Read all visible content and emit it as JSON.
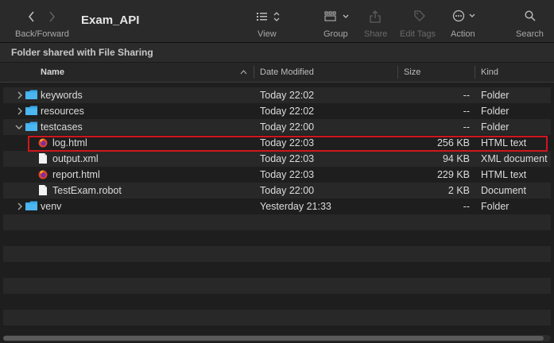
{
  "window": {
    "title": "Exam_API"
  },
  "toolbar": {
    "back_forward_label": "Back/Forward",
    "view_label": "View",
    "group_label": "Group",
    "share_label": "Share",
    "edit_tags_label": "Edit Tags",
    "action_label": "Action",
    "search_label": "Search"
  },
  "pathbar": {
    "text": "Folder shared with File Sharing"
  },
  "columns": {
    "name": "Name",
    "date_modified": "Date Modified",
    "size": "Size",
    "kind": "Kind"
  },
  "rows": [
    {
      "name": "keywords",
      "date": "Today 22:02",
      "size": "--",
      "kind": "Folder",
      "icon": "folder-icon",
      "expanded": false
    },
    {
      "name": "resources",
      "date": "Today 22:02",
      "size": "--",
      "kind": "Folder",
      "icon": "folder-icon",
      "expanded": false
    },
    {
      "name": "testcases",
      "date": "Today 22:00",
      "size": "--",
      "kind": "Folder",
      "icon": "folder-icon",
      "expanded": true
    },
    {
      "name": "log.html",
      "date": "Today 22:03",
      "size": "256 KB",
      "kind": "HTML text",
      "icon": "firefox-html-icon"
    },
    {
      "name": "output.xml",
      "date": "Today 22:03",
      "size": "94 KB",
      "kind": "XML document",
      "icon": "document-icon"
    },
    {
      "name": "report.html",
      "date": "Today 22:03",
      "size": "229 KB",
      "kind": "HTML text",
      "icon": "firefox-html-icon"
    },
    {
      "name": "TestExam.robot",
      "date": "Today 22:00",
      "size": "2 KB",
      "kind": "Document",
      "icon": "document-icon"
    },
    {
      "name": "venv",
      "date": "Yesterday 21:33",
      "size": "--",
      "kind": "Folder",
      "icon": "folder-icon",
      "expanded": false
    }
  ],
  "colors": {
    "folder": "#39a9e8",
    "highlight": "#d0161e"
  }
}
